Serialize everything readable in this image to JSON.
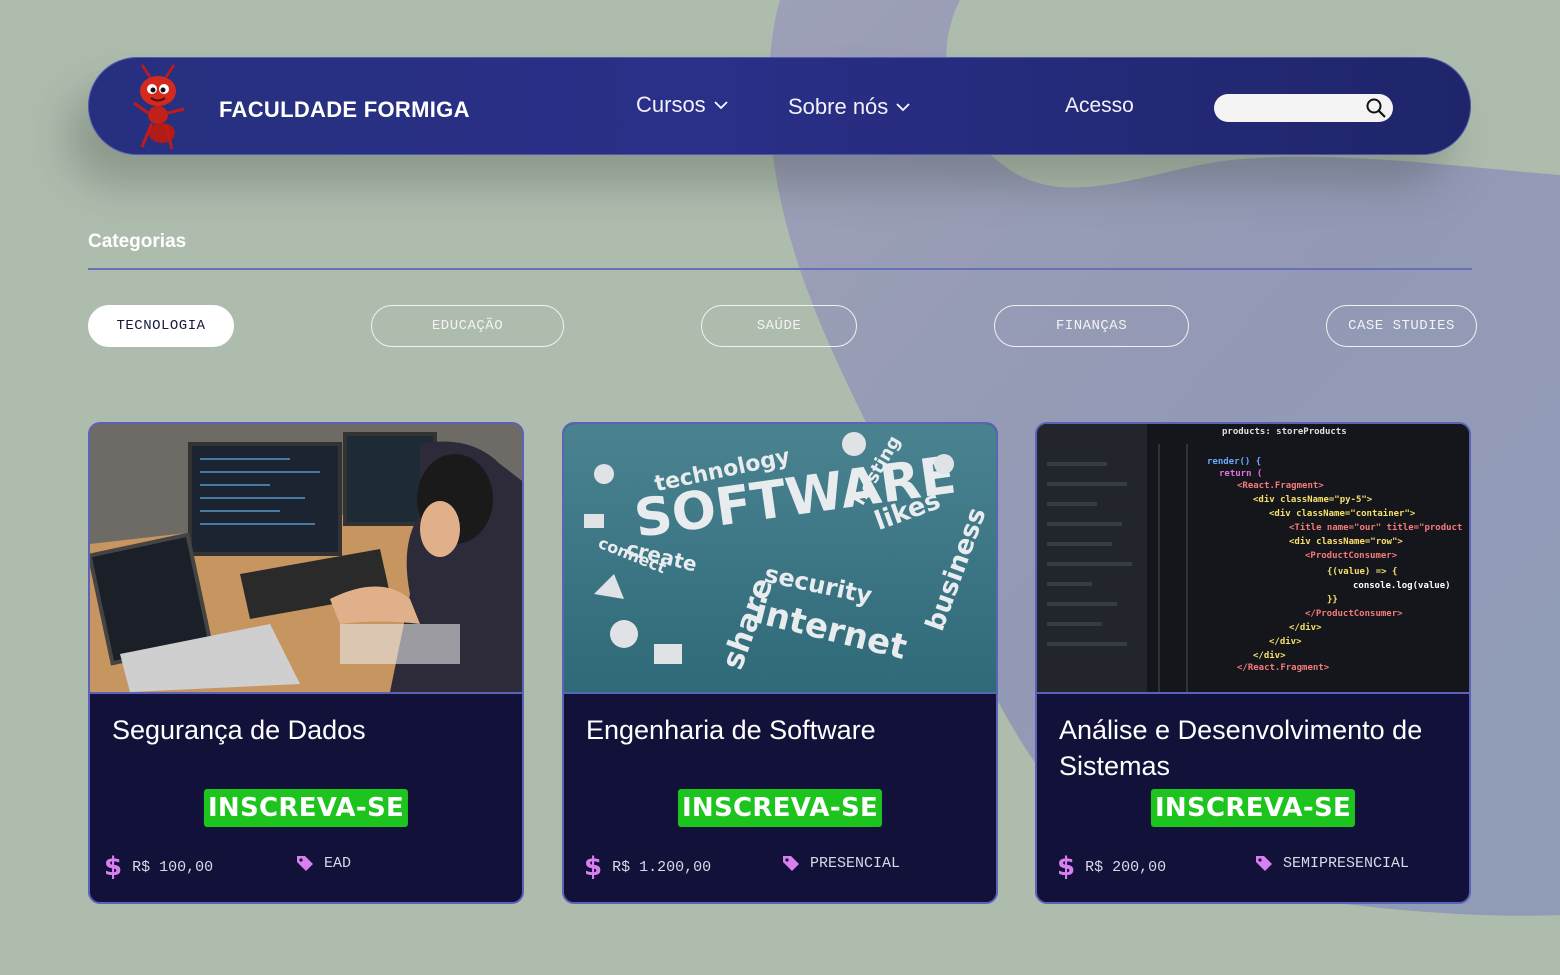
{
  "brand": {
    "name": "FACULDADE FORMIGA",
    "logo_icon": "ant-mascot-icon"
  },
  "nav": {
    "items": [
      {
        "label": "Cursos",
        "has_dropdown": true
      },
      {
        "label": "Sobre nós",
        "has_dropdown": true
      },
      {
        "label": "Acesso",
        "has_dropdown": false
      }
    ],
    "search": {
      "placeholder": "",
      "icon": "search-icon"
    }
  },
  "categories": {
    "title": "Categorias",
    "pills": [
      {
        "label": "TECNOLOGIA",
        "active": true
      },
      {
        "label": "EDUCAÇÃO",
        "active": false
      },
      {
        "label": "SAÚDE",
        "active": false
      },
      {
        "label": "FINANÇAS",
        "active": false
      },
      {
        "label": "CASE STUDIES",
        "active": false
      }
    ]
  },
  "courses": [
    {
      "title": "Segurança de Dados",
      "cta": "INSCREVA-SE",
      "price": "R$ 100,00",
      "modality": "EAD"
    },
    {
      "title": "Engenharia de Software",
      "cta": "INSCREVA-SE",
      "price": "R$ 1.200,00",
      "modality": "PRESENCIAL"
    },
    {
      "title": "Análise e Desenvolvimento de Sistemas",
      "cta": "INSCREVA-SE",
      "price": "R$ 200,00",
      "modality": "SEMIPRESENCIAL"
    }
  ],
  "colors": {
    "background": "#aebcae",
    "navbar": "#27307f",
    "card": "#11113a",
    "cta": "#1ec41e",
    "accent_pink": "#d980f0"
  }
}
